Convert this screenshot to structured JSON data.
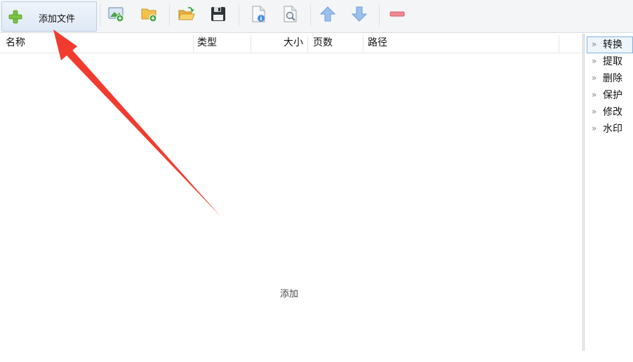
{
  "toolbar": {
    "add_file_label": "添加文件"
  },
  "table": {
    "columns": [
      "名称",
      "类型",
      "大小",
      "页数",
      "路径"
    ],
    "empty_text": "添加"
  },
  "side_menu": {
    "items": [
      {
        "label": "转换",
        "active": true
      },
      {
        "label": "提取",
        "active": false
      },
      {
        "label": "删除",
        "active": false
      },
      {
        "label": "保护",
        "active": false
      },
      {
        "label": "修改",
        "active": false
      },
      {
        "label": "水印",
        "active": false
      }
    ],
    "chevron": "»"
  },
  "colors": {
    "accent": "#7fb2e5",
    "plus_icon": "#7cc242",
    "arrow_up": "#7aa9e8",
    "remove": "#e6707a",
    "folder": "#f2c14e",
    "annotation_arrow": "#f23b2f"
  }
}
